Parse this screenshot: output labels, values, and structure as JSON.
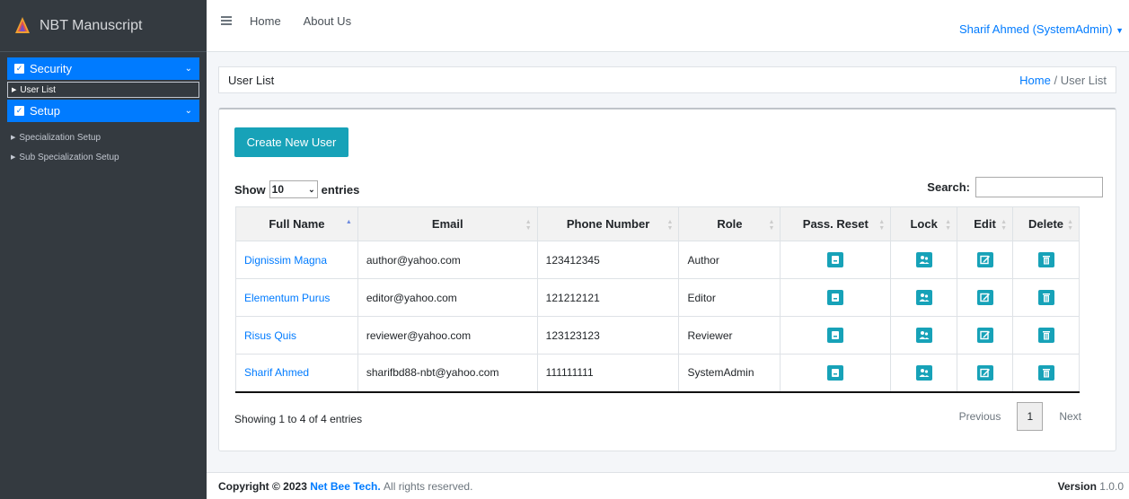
{
  "app": {
    "name": "NBT Manuscript"
  },
  "sidebar": {
    "groups": [
      {
        "label": "Security",
        "items": [
          {
            "label": "User List",
            "active": true
          }
        ]
      },
      {
        "label": "Setup",
        "items": [
          {
            "label": "Specialization Setup"
          },
          {
            "label": "Sub Specialization Setup"
          }
        ]
      }
    ]
  },
  "topnav": {
    "home": "Home",
    "about": "About Us",
    "user": "Sharif Ahmed (SystemAdmin)"
  },
  "page": {
    "title": "User List",
    "breadcrumb_home": "Home",
    "breadcrumb_sep": "/",
    "breadcrumb_current": "User List"
  },
  "toolbar": {
    "create_label": "Create New User",
    "show_label": "Show",
    "entries_value": "10",
    "entries_label": "entries",
    "search_label": "Search:"
  },
  "table": {
    "columns": [
      "Full Name",
      "Email",
      "Phone Number",
      "Role",
      "Pass. Reset",
      "Lock",
      "Edit",
      "Delete"
    ],
    "rows": [
      {
        "name": "Dignissim Magna",
        "email": "author@yahoo.com",
        "phone": "123412345",
        "role": "Author"
      },
      {
        "name": "Elementum Purus",
        "email": "editor@yahoo.com",
        "phone": "121212121",
        "role": "Editor"
      },
      {
        "name": "Risus Quis",
        "email": "reviewer@yahoo.com",
        "phone": "123123123",
        "role": "Reviewer"
      },
      {
        "name": "Sharif Ahmed",
        "email": "sharifbd88-nbt@yahoo.com",
        "phone": "111111111",
        "role": "SystemAdmin"
      }
    ]
  },
  "pagination": {
    "info": "Showing 1 to 4 of 4 entries",
    "previous": "Previous",
    "page": "1",
    "next": "Next"
  },
  "footer": {
    "copyright": "Copyright © 2023",
    "company": "Net Bee Tech.",
    "rights": "All rights reserved.",
    "version_label": "Version",
    "version": "1.0.0"
  },
  "colors": {
    "sidebar_bg": "#343a40",
    "primary": "#007bff",
    "accent": "#17a2b8"
  }
}
